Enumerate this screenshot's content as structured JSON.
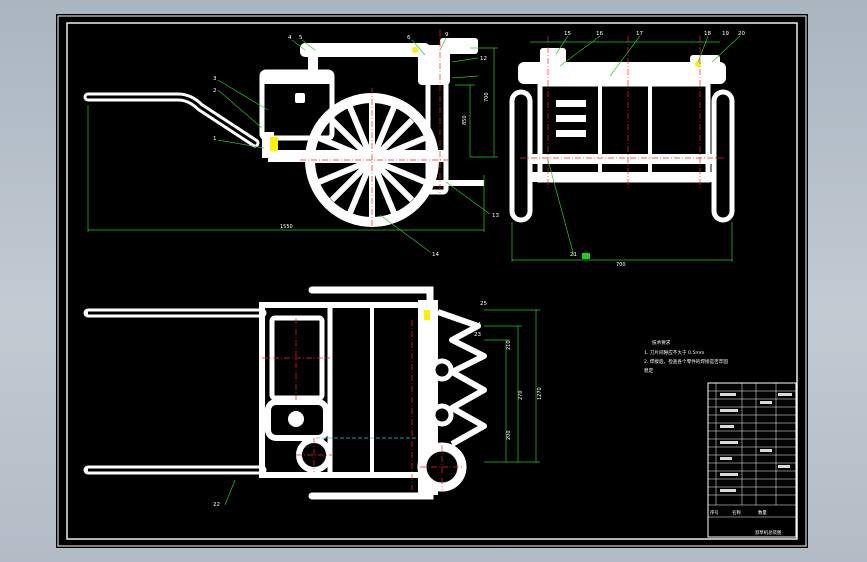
{
  "drawing": {
    "part_labels": {
      "n1": "1",
      "n2": "2",
      "n3": "3",
      "n4": "4",
      "n5": "5",
      "n6": "6",
      "n9": "9",
      "n12": "12",
      "n13": "13",
      "n14": "14",
      "n15": "15",
      "n16": "16",
      "n17": "17",
      "n18": "18",
      "n19": "19",
      "n20": "20",
      "n21": "21",
      "n22": "22",
      "n23": "23",
      "n24": "24",
      "n25": "25"
    },
    "dimensions": {
      "overall_length": "1550",
      "front_width": "700",
      "heights": [
        "700",
        "850",
        "430",
        "214"
      ],
      "plan_dims": [
        "200",
        "210",
        "270",
        "1270"
      ]
    },
    "notes": {
      "title": "技术要求",
      "line1": "1. 刀片间隙应不大于 0.5mm",
      "line2": "2. 焊接后，检查各个零件的焊接是否牢固",
      "line3": "稳定"
    },
    "title_block": {
      "project": "割草机总装图",
      "rows": [
        "序号",
        "代号",
        "名称",
        "数量",
        "材料",
        "备注"
      ]
    },
    "colors": {
      "background": "#000000",
      "part": "#ffffff",
      "centerline": "#ff2020",
      "dimension": "#22cc22",
      "leader": "#22cc22",
      "accent_yellow": "#ffee00",
      "hidden": "#33cccc"
    }
  }
}
